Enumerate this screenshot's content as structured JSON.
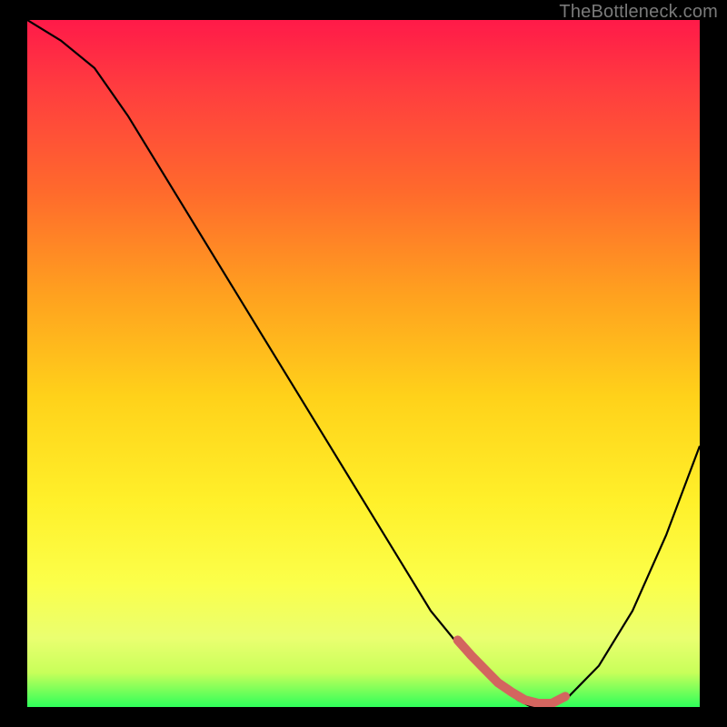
{
  "watermark": "TheBottleneck.com",
  "chart_data": {
    "type": "line",
    "title": "",
    "xlabel": "",
    "ylabel": "",
    "xlim": [
      0,
      100
    ],
    "ylim": [
      0,
      100
    ],
    "x": [
      0,
      5,
      10,
      15,
      20,
      25,
      30,
      35,
      40,
      45,
      50,
      55,
      60,
      65,
      70,
      73,
      75,
      78,
      80,
      85,
      90,
      95,
      100
    ],
    "values": [
      100,
      97,
      93,
      86,
      78,
      70,
      62,
      54,
      46,
      38,
      30,
      22,
      14,
      8,
      3,
      1,
      0,
      0,
      1,
      6,
      14,
      25,
      38
    ],
    "notes": "Percentage-style curve: descends from top-left, bottoms out near x≈75-78 at y≈0, then rises to the right.",
    "accent_region_x": [
      64,
      80
    ]
  },
  "colors": {
    "background": "#000000",
    "gradient_top": "#ff1a49",
    "gradient_bottom": "#2eff5a",
    "curve": "#000000",
    "accent": "#d3655f",
    "watermark": "#7a7a7a"
  }
}
